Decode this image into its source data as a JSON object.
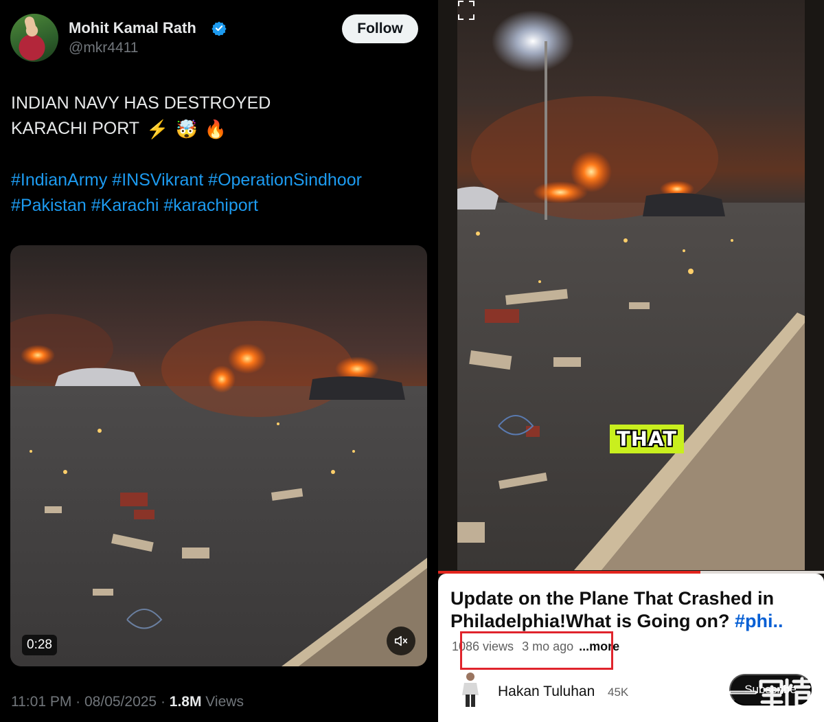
{
  "tweet": {
    "display_name": "Mohit Kamal Rath",
    "handle": "@mkr4411",
    "follow_label": "Follow",
    "text_line1": "INDIAN NAVY HAS DESTROYED",
    "text_line2": "KARACHI PORT",
    "emoji": [
      "⚡",
      "🤯",
      "🔥"
    ],
    "hashtags_line1": "#IndianArmy #INSVikrant #OperationSindhoor",
    "hashtags_line2": "#Pakistan #Karachi #karachiport",
    "video_duration": "0:28",
    "time": "11:01 PM",
    "date": "08/05/2025",
    "separator": " · ",
    "views_count": "1.8M",
    "views_label": " Views",
    "colors": {
      "background": "#000000",
      "link": "#1d9bf0",
      "verified": "#1d9bf0"
    }
  },
  "shorts": {
    "caption_overlay": "THAT",
    "progress_fraction": 0.68,
    "title_text": "Update on the Plane That Crashed in Philadelphia!What is Going on? ",
    "title_hashtag": "#phi..",
    "views": "1086 views",
    "age": "3 mo ago",
    "more_label": "...more",
    "channel_name": "Hakan Tuluhan",
    "subscriber_count": "45K",
    "subscribe_label": "Subscribe",
    "colors": {
      "progress": "#e2251d",
      "highlight_box": "#e0242c",
      "hashtag": "#065fd4"
    }
  },
  "watermark": {
    "text": "第一军情"
  }
}
